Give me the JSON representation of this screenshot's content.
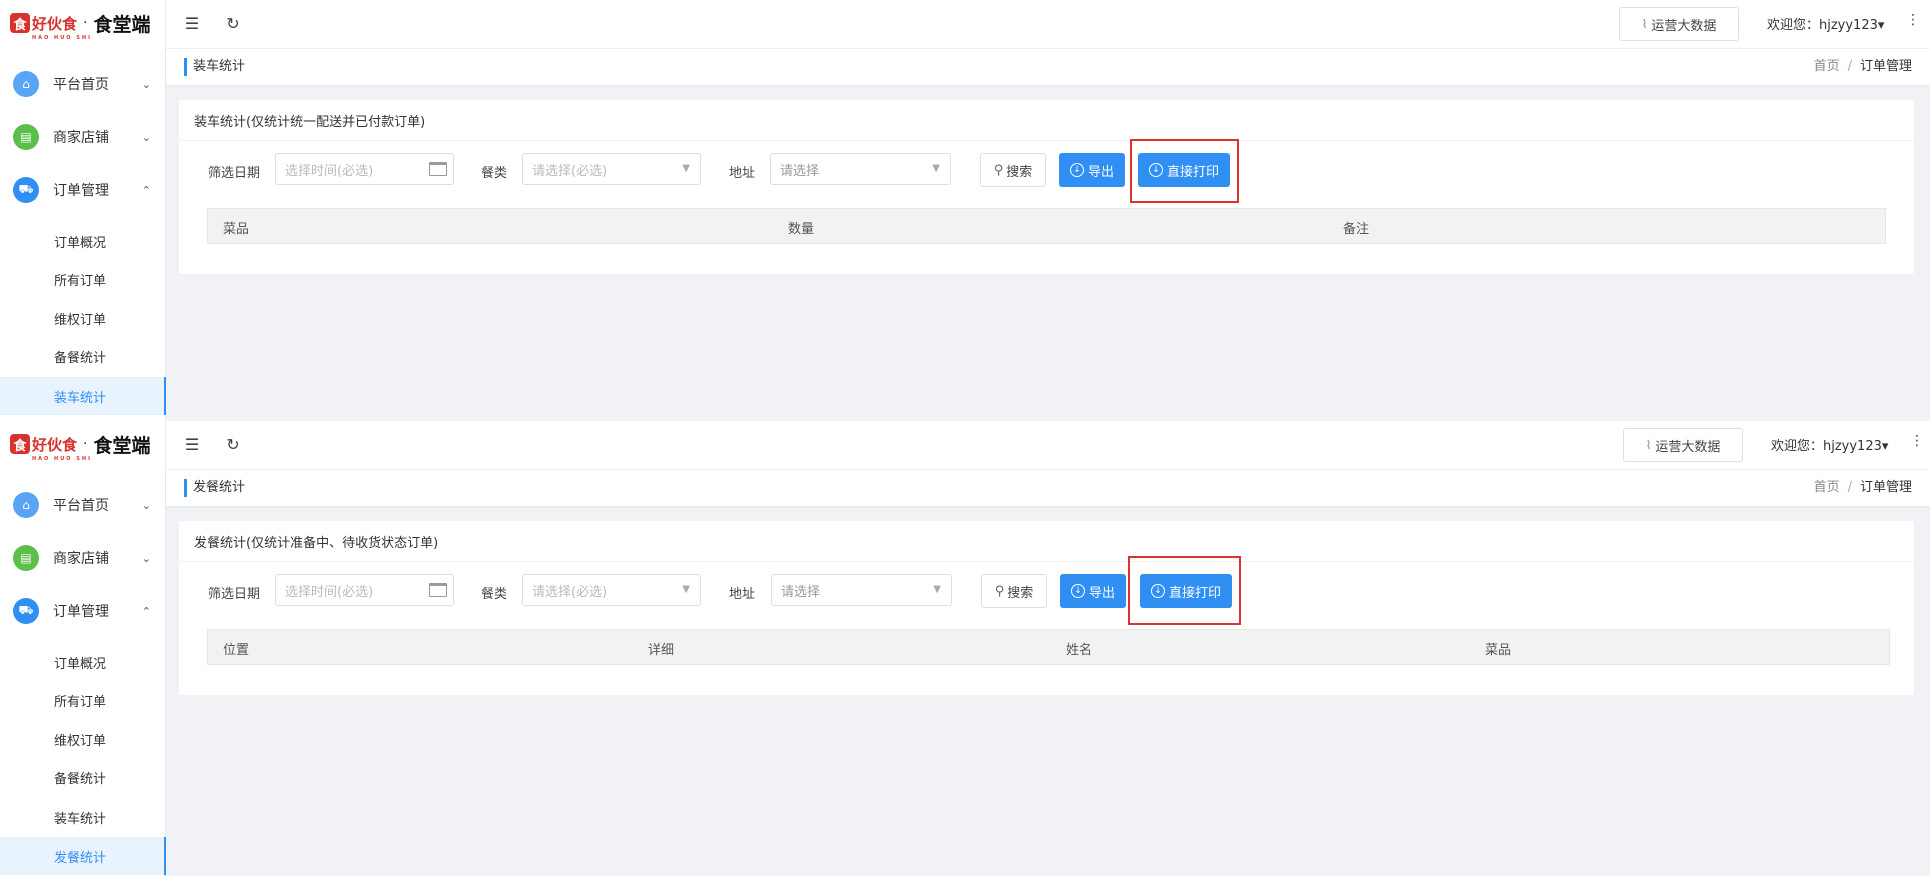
{
  "app": {
    "brand": "好伙食",
    "brand_pinyin": "HAO HUO SHI",
    "separator": "·",
    "app_name": "食堂端",
    "logo_glyph": "食"
  },
  "colors": {
    "primary": "#2f8ff2",
    "brand_red": "#d6322e",
    "highlight": "#e0322d"
  },
  "sidebar": {
    "groups": [
      {
        "label": "平台首页",
        "icon": "home-icon",
        "glyph": "⌂",
        "color": "#5aa4f5",
        "expanded": false
      },
      {
        "label": "商家店铺",
        "icon": "store-icon",
        "glyph": "▤",
        "color": "#5cbf4a",
        "expanded": false
      },
      {
        "label": "订单管理",
        "icon": "cart-icon",
        "glyph": "⛟",
        "color": "#2f8ff2",
        "expanded": true
      }
    ],
    "chevron_down": "⌄",
    "chevron_up": "⌃",
    "sub_items": [
      "订单概况",
      "所有订单",
      "维权订单",
      "备餐统计",
      "装车统计",
      "发餐统计"
    ]
  },
  "header": {
    "menu_glyph": "☰",
    "refresh_glyph": "↻",
    "ops_glyph": "⌇",
    "ops_label": "运营大数据",
    "welcome": "欢迎您：hjzyy123▾",
    "kebab_glyph": "⋮"
  },
  "breadcrumb": {
    "home": "首页",
    "sep": "/",
    "current": "订单管理"
  },
  "filters": {
    "date_label": "筛选日期",
    "date_placeholder": "选择时间(必选)",
    "meal_label": "餐类",
    "meal_placeholder": "请选择(必选)",
    "address_label": "地址",
    "address_placeholder": "请选择",
    "caret_glyph": "▼",
    "search_glyph": "⚲",
    "search_label": "搜索",
    "download_glyph": "↓",
    "export_label": "导出",
    "print_label": "直接打印"
  },
  "frames": [
    {
      "active_index": 4,
      "page_tag": "装车统计",
      "card_title": "装车统计(仅统计统一配送并已付款订单)",
      "columns": [
        "菜品",
        "数量",
        "备注"
      ]
    },
    {
      "active_index": 5,
      "page_tag": "发餐统计",
      "card_title": "发餐统计(仅统计准备中、待收货状态订单)",
      "columns": [
        "位置",
        "详细",
        "姓名",
        "菜品"
      ]
    }
  ]
}
